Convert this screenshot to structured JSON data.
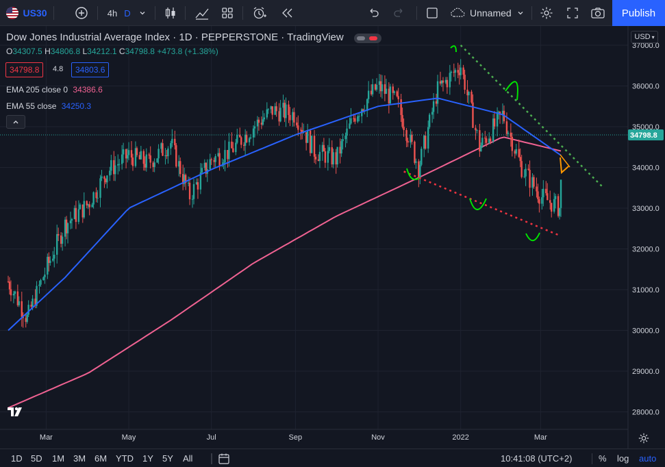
{
  "toolbar": {
    "symbol": "US30",
    "interval": "4h",
    "interval_alt": "D",
    "layout_name": "Unnamed",
    "publish_label": "Publish"
  },
  "legend": {
    "title": "Dow Jones Industrial Average Index · 1D · PEPPERSTONE · TradingView",
    "o_key": "O",
    "o_val": "34307.5",
    "h_key": "H",
    "h_val": "34806.8",
    "l_key": "L",
    "l_val": "34212.1",
    "c_key": "C",
    "c_val": "34798.8",
    "change": "+473.8 (+1.38%)",
    "bid": "34798.8",
    "spread": "4.8",
    "ask": "34803.6",
    "ema1_label": "EMA 205 close 0",
    "ema1_value": "34386.6",
    "ema2_label": "EMA 55 close",
    "ema2_value": "34250.3",
    "collapse_icon": "^"
  },
  "colors": {
    "background": "#131722",
    "up": "#26a69a",
    "down": "#ef5350",
    "ema205": "#f06292",
    "ema55": "#2962ff",
    "accent": "#2962ff",
    "annotation_green": "#00e600",
    "annotation_red": "#ef3340",
    "annotation_orange": "#ff9800"
  },
  "price_axis": {
    "currency": "USD",
    "ticks": [
      "37000.0",
      "36000.0",
      "35000.0",
      "34000.0",
      "33000.0",
      "32000.0",
      "31000.0",
      "30000.0",
      "29000.0",
      "28000.0"
    ],
    "last_price": "34798.8"
  },
  "time_axis": {
    "ticks": [
      "Mar",
      "May",
      "Jul",
      "Sep",
      "Nov",
      "2022",
      "Mar"
    ]
  },
  "bottom_bar": {
    "ranges": [
      "1D",
      "5D",
      "1M",
      "3M",
      "6M",
      "YTD",
      "1Y",
      "5Y",
      "All"
    ],
    "clock": "10:41:08 (UTC+2)",
    "percent": "%",
    "log": "log",
    "auto": "auto"
  },
  "chart_data": {
    "type": "line",
    "series": [
      {
        "name": "Dow Jones Industrial Average Index",
        "x": [
          "2021-02-01",
          "2021-02-15",
          "2021-03-01",
          "2021-03-15",
          "2021-04-01",
          "2021-04-15",
          "2021-05-01",
          "2021-05-15",
          "2021-06-01",
          "2021-06-15",
          "2021-07-01",
          "2021-07-15",
          "2021-08-01",
          "2021-08-15",
          "2021-09-01",
          "2021-09-15",
          "2021-10-01",
          "2021-10-15",
          "2021-11-01",
          "2021-11-15",
          "2021-12-01",
          "2021-12-15",
          "2022-01-01",
          "2022-01-15",
          "2022-02-01",
          "2022-02-15",
          "2022-03-01",
          "2022-03-15",
          "2022-03-18"
        ],
        "values": [
          31200,
          30300,
          31500,
          32600,
          33100,
          33900,
          34300,
          34100,
          34600,
          33300,
          34200,
          34400,
          35000,
          35400,
          35300,
          34400,
          34200,
          35300,
          36000,
          35600,
          34000,
          35900,
          36500,
          34500,
          35300,
          34000,
          33300,
          33000,
          34798.8
        ]
      },
      {
        "name": "EMA 205 close 0",
        "x": [
          "2021-02-01",
          "2021-04-01",
          "2021-06-01",
          "2021-08-01",
          "2021-10-01",
          "2021-12-01",
          "2022-01-01",
          "2022-02-01",
          "2022-03-18"
        ],
        "values": [
          28100,
          28950,
          30250,
          31650,
          32800,
          33750,
          34250,
          34750,
          34386.6
        ]
      },
      {
        "name": "EMA 55 close",
        "x": [
          "2021-02-01",
          "2021-03-15",
          "2021-05-01",
          "2021-07-01",
          "2021-09-01",
          "2021-11-01",
          "2021-12-15",
          "2022-02-01",
          "2022-03-18"
        ],
        "values": [
          30000,
          31300,
          33000,
          33950,
          34800,
          35500,
          35700,
          35300,
          34250.3
        ]
      }
    ],
    "ylim": [
      27700,
      37000
    ],
    "xlabel": "",
    "ylabel": "",
    "grid": true
  }
}
